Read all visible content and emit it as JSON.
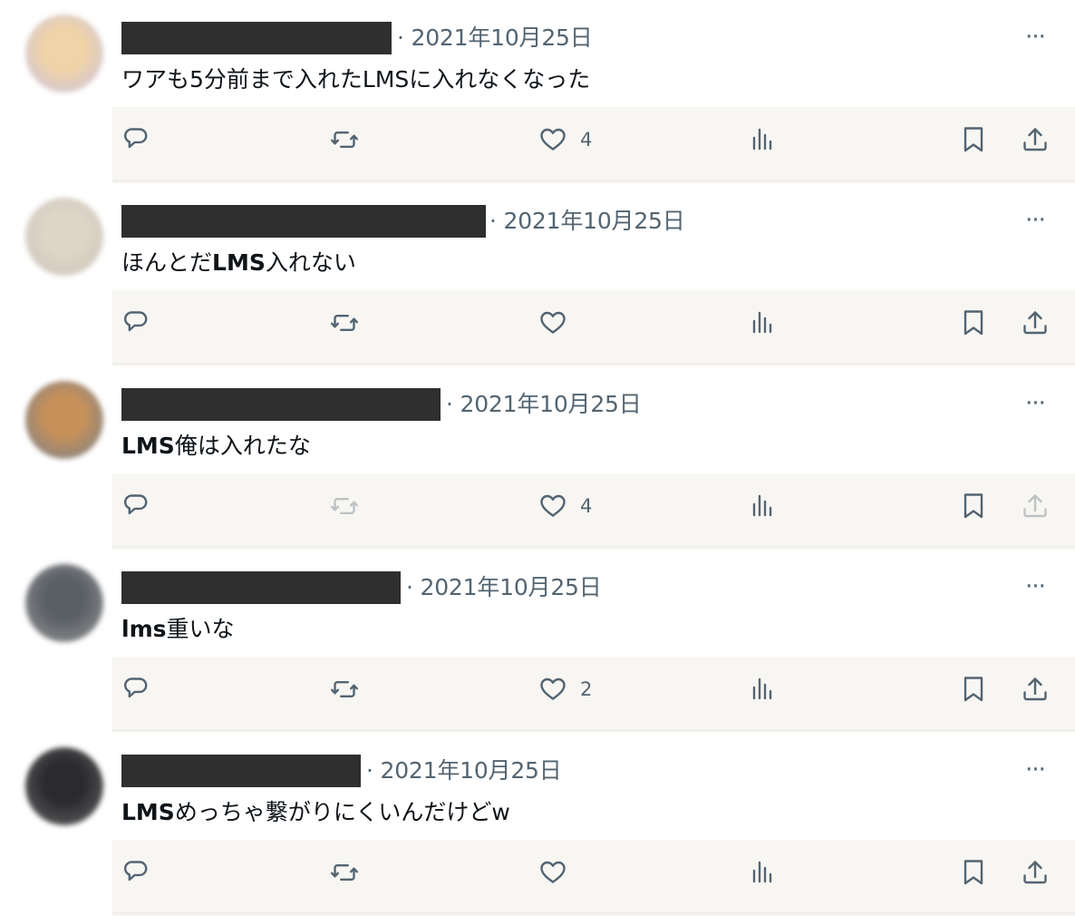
{
  "colors": {
    "background": "#ffffff",
    "action_band": "#f7f6f2",
    "text_primary": "#0f1419",
    "text_secondary": "#536471",
    "redaction": "#2f2f2f"
  },
  "tweets": [
    {
      "date": "· 2021年10月25日",
      "more_label": "···",
      "text_segments": [
        {
          "text": "ワアも5分前まで入れたLMSに入れなくなった",
          "bold": false
        }
      ],
      "like_count": "4",
      "avatar": {
        "name": "avatar",
        "color_a": "#f0d3a6",
        "color_b": "#c7c2e6"
      },
      "retweet_faded": false,
      "share_faded": false
    },
    {
      "date": "· 2021年10月25日",
      "more_label": "···",
      "text_segments": [
        {
          "text": "ほんとだ",
          "bold": false
        },
        {
          "text": "LMS",
          "bold": true
        },
        {
          "text": "入れない",
          "bold": false
        }
      ],
      "like_count": "",
      "avatar": {
        "name": "avatar",
        "color_a": "#ddd5c8",
        "color_b": "#cbc3b6"
      },
      "retweet_faded": false,
      "share_faded": false
    },
    {
      "date": "· 2021年10月25日",
      "more_label": "···",
      "text_segments": [
        {
          "text": "LMS",
          "bold": true
        },
        {
          "text": "俺は入れたな",
          "bold": false
        }
      ],
      "like_count": "4",
      "avatar": {
        "name": "avatar",
        "color_a": "#c7905a",
        "color_b": "#6f8090"
      },
      "retweet_faded": true,
      "share_faded": true
    },
    {
      "date": "· 2021年10月25日",
      "more_label": "···",
      "text_segments": [
        {
          "text": "lms",
          "bold": true
        },
        {
          "text": "重いな",
          "bold": false
        }
      ],
      "like_count": "2",
      "avatar": {
        "name": "avatar",
        "color_a": "#5a5f66",
        "color_b": "#9b9a98"
      },
      "retweet_faded": false,
      "share_faded": false
    },
    {
      "date": "· 2021年10月25日",
      "more_label": "···",
      "text_segments": [
        {
          "text": "LMS",
          "bold": true
        },
        {
          "text": "めっちゃ繋がりにくいんだけどw",
          "bold": false
        }
      ],
      "like_count": "",
      "avatar": {
        "name": "avatar",
        "color_a": "#2b2b2d",
        "color_b": "#6a6a6c"
      },
      "retweet_faded": false,
      "share_faded": false
    }
  ],
  "action_icons": [
    "reply-icon",
    "retweet-icon",
    "like-icon",
    "views-icon",
    "bookmark-icon",
    "share-icon"
  ]
}
